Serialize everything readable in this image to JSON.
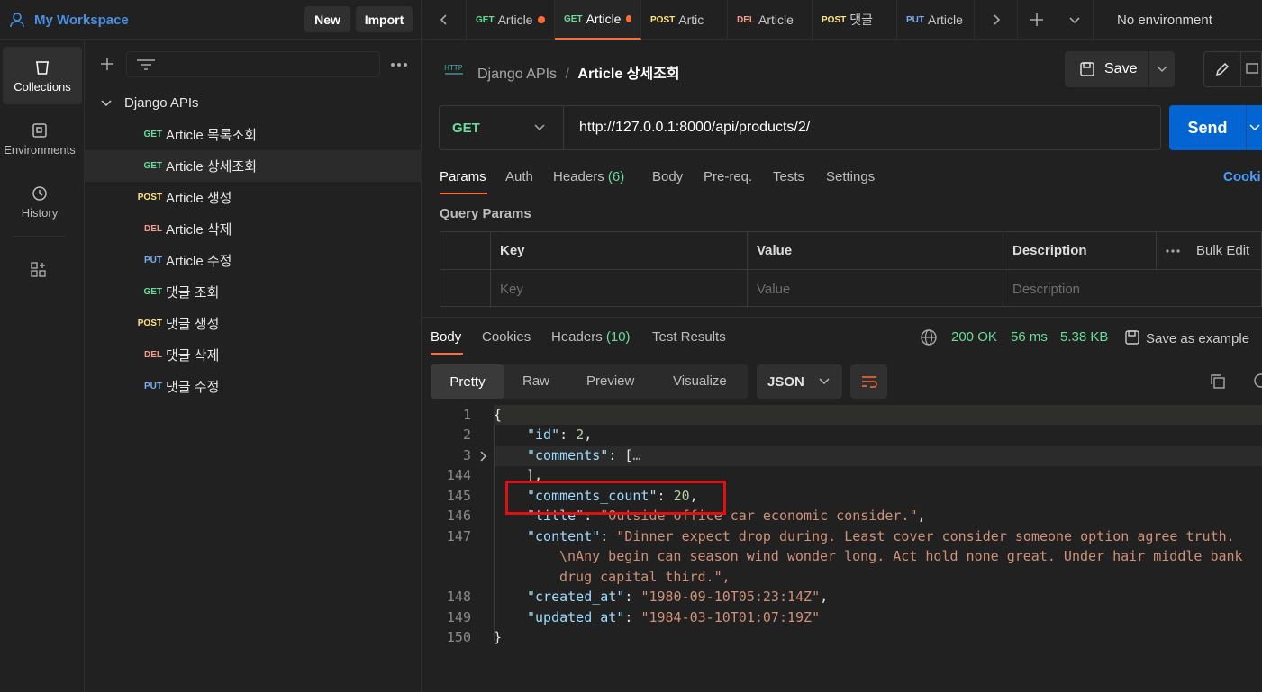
{
  "workspace": {
    "name": "My Workspace",
    "new_label": "New",
    "import_label": "Import"
  },
  "tabs": [
    {
      "method": "GET",
      "title": "Article",
      "unsaved": true
    },
    {
      "method": "GET",
      "title": "Article",
      "unsaved": true,
      "active": true
    },
    {
      "method": "POST",
      "title": "Artic"
    },
    {
      "method": "DEL",
      "title": "Article"
    },
    {
      "method": "POST",
      "title": "댓글"
    },
    {
      "method": "PUT",
      "title": "Article"
    }
  ],
  "environment": "No environment",
  "rail": [
    {
      "label": "Collections",
      "icon": "collections-icon"
    },
    {
      "label": "Environments",
      "icon": "environments-icon"
    },
    {
      "label": "History",
      "icon": "history-icon"
    }
  ],
  "collection": {
    "name": "Django APIs",
    "items": [
      {
        "method": "GET",
        "name": "Article 목록조회"
      },
      {
        "method": "GET",
        "name": "Article 상세조회",
        "active": true
      },
      {
        "method": "POST",
        "name": "Article 생성"
      },
      {
        "method": "DEL",
        "name": "Article 삭제"
      },
      {
        "method": "PUT",
        "name": "Article 수정"
      },
      {
        "method": "GET",
        "name": "댓글 조회"
      },
      {
        "method": "POST",
        "name": "댓글 생성"
      },
      {
        "method": "DEL",
        "name": "댓글 삭제"
      },
      {
        "method": "PUT",
        "name": "댓글 수정"
      }
    ]
  },
  "breadcrumb": {
    "parent": "Django APIs",
    "separator": "/",
    "current": "Article 상세조회"
  },
  "save_label": "Save",
  "request": {
    "method": "GET",
    "url": "http://127.0.0.1:8000/api/products/2/",
    "send_label": "Send"
  },
  "request_tabs": {
    "params": "Params",
    "auth": "Auth",
    "headers": "Headers",
    "headers_count": "(6)",
    "body": "Body",
    "prereq": "Pre-req.",
    "tests": "Tests",
    "settings": "Settings",
    "cookies": "Cooki"
  },
  "query_params": {
    "title": "Query Params",
    "headers": {
      "key": "Key",
      "value": "Value",
      "description": "Description",
      "bulk": "Bulk Edit"
    },
    "placeholders": {
      "key": "Key",
      "value": "Value",
      "description": "Description"
    }
  },
  "response": {
    "tabs": {
      "body": "Body",
      "cookies": "Cookies",
      "headers": "Headers",
      "headers_count": "(10)",
      "tests": "Test Results"
    },
    "status": "200 OK",
    "time": "56 ms",
    "size": "5.38 KB",
    "save_example": "Save as example",
    "views": {
      "pretty": "Pretty",
      "raw": "Raw",
      "preview": "Preview",
      "visualize": "Visualize",
      "format": "JSON"
    },
    "lines": [
      {
        "n": "1",
        "text": "{"
      },
      {
        "n": "2",
        "key": "\"id\"",
        "rest": ": ",
        "val": "2",
        "tail": ",",
        "vtype": "num"
      },
      {
        "n": "3",
        "key": "\"comments\"",
        "rest": ": [",
        "val": "…",
        "tail": "",
        "vtype": "plain"
      },
      {
        "n": "144",
        "text": "    ],"
      },
      {
        "n": "145",
        "key": "\"comments_count\"",
        "rest": ": ",
        "val": "20",
        "tail": ",",
        "vtype": "num"
      },
      {
        "n": "146",
        "key": "\"title\"",
        "rest": ": ",
        "val": "\"Outside office car economic consider.\"",
        "tail": ",",
        "vtype": "str"
      },
      {
        "n": "147",
        "key": "\"content\"",
        "rest": ": ",
        "val": "\"Dinner expect drop during. Least cover consider someone option agree truth.",
        "tail": "",
        "vtype": "str"
      },
      {
        "n": "",
        "text": "\\nAny begin can season wind wonder long. Act hold none great. Under hair middle bank",
        "vtype": "str"
      },
      {
        "n": "",
        "text": "drug capital third.\",",
        "vtype": "str"
      },
      {
        "n": "148",
        "key": "\"created_at\"",
        "rest": ": ",
        "val": "\"1980-09-10T05:23:14Z\"",
        "tail": ",",
        "vtype": "str"
      },
      {
        "n": "149",
        "key": "\"updated_at\"",
        "rest": ": ",
        "val": "\"1984-03-10T01:07:19Z\"",
        "tail": "",
        "vtype": "str"
      },
      {
        "n": "150",
        "text": "}"
      }
    ]
  },
  "colors": {
    "accent": "#ff6c37",
    "send": "#0265d2",
    "get": "#6bdd9a",
    "post": "#ffe47e",
    "del": "#f79a8e",
    "put": "#74aef6",
    "highlight_box": "#e01010"
  }
}
